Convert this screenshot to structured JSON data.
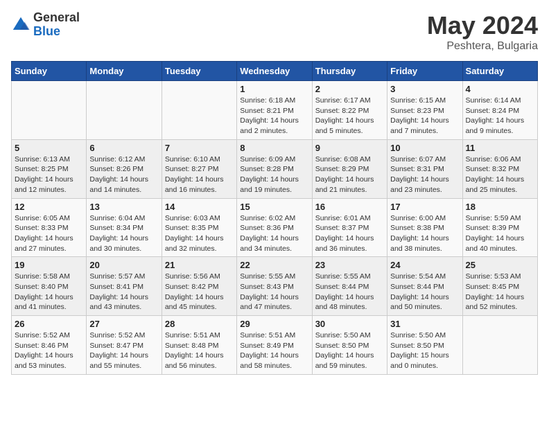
{
  "logo": {
    "general": "General",
    "blue": "Blue"
  },
  "title": {
    "month_year": "May 2024",
    "location": "Peshtera, Bulgaria"
  },
  "days_of_week": [
    "Sunday",
    "Monday",
    "Tuesday",
    "Wednesday",
    "Thursday",
    "Friday",
    "Saturday"
  ],
  "weeks": [
    [
      {
        "day": "",
        "info": ""
      },
      {
        "day": "",
        "info": ""
      },
      {
        "day": "",
        "info": ""
      },
      {
        "day": "1",
        "info": "Sunrise: 6:18 AM\nSunset: 8:21 PM\nDaylight: 14 hours\nand 2 minutes."
      },
      {
        "day": "2",
        "info": "Sunrise: 6:17 AM\nSunset: 8:22 PM\nDaylight: 14 hours\nand 5 minutes."
      },
      {
        "day": "3",
        "info": "Sunrise: 6:15 AM\nSunset: 8:23 PM\nDaylight: 14 hours\nand 7 minutes."
      },
      {
        "day": "4",
        "info": "Sunrise: 6:14 AM\nSunset: 8:24 PM\nDaylight: 14 hours\nand 9 minutes."
      }
    ],
    [
      {
        "day": "5",
        "info": "Sunrise: 6:13 AM\nSunset: 8:25 PM\nDaylight: 14 hours\nand 12 minutes."
      },
      {
        "day": "6",
        "info": "Sunrise: 6:12 AM\nSunset: 8:26 PM\nDaylight: 14 hours\nand 14 minutes."
      },
      {
        "day": "7",
        "info": "Sunrise: 6:10 AM\nSunset: 8:27 PM\nDaylight: 14 hours\nand 16 minutes."
      },
      {
        "day": "8",
        "info": "Sunrise: 6:09 AM\nSunset: 8:28 PM\nDaylight: 14 hours\nand 19 minutes."
      },
      {
        "day": "9",
        "info": "Sunrise: 6:08 AM\nSunset: 8:29 PM\nDaylight: 14 hours\nand 21 minutes."
      },
      {
        "day": "10",
        "info": "Sunrise: 6:07 AM\nSunset: 8:31 PM\nDaylight: 14 hours\nand 23 minutes."
      },
      {
        "day": "11",
        "info": "Sunrise: 6:06 AM\nSunset: 8:32 PM\nDaylight: 14 hours\nand 25 minutes."
      }
    ],
    [
      {
        "day": "12",
        "info": "Sunrise: 6:05 AM\nSunset: 8:33 PM\nDaylight: 14 hours\nand 27 minutes."
      },
      {
        "day": "13",
        "info": "Sunrise: 6:04 AM\nSunset: 8:34 PM\nDaylight: 14 hours\nand 30 minutes."
      },
      {
        "day": "14",
        "info": "Sunrise: 6:03 AM\nSunset: 8:35 PM\nDaylight: 14 hours\nand 32 minutes."
      },
      {
        "day": "15",
        "info": "Sunrise: 6:02 AM\nSunset: 8:36 PM\nDaylight: 14 hours\nand 34 minutes."
      },
      {
        "day": "16",
        "info": "Sunrise: 6:01 AM\nSunset: 8:37 PM\nDaylight: 14 hours\nand 36 minutes."
      },
      {
        "day": "17",
        "info": "Sunrise: 6:00 AM\nSunset: 8:38 PM\nDaylight: 14 hours\nand 38 minutes."
      },
      {
        "day": "18",
        "info": "Sunrise: 5:59 AM\nSunset: 8:39 PM\nDaylight: 14 hours\nand 40 minutes."
      }
    ],
    [
      {
        "day": "19",
        "info": "Sunrise: 5:58 AM\nSunset: 8:40 PM\nDaylight: 14 hours\nand 41 minutes."
      },
      {
        "day": "20",
        "info": "Sunrise: 5:57 AM\nSunset: 8:41 PM\nDaylight: 14 hours\nand 43 minutes."
      },
      {
        "day": "21",
        "info": "Sunrise: 5:56 AM\nSunset: 8:42 PM\nDaylight: 14 hours\nand 45 minutes."
      },
      {
        "day": "22",
        "info": "Sunrise: 5:55 AM\nSunset: 8:43 PM\nDaylight: 14 hours\nand 47 minutes."
      },
      {
        "day": "23",
        "info": "Sunrise: 5:55 AM\nSunset: 8:44 PM\nDaylight: 14 hours\nand 48 minutes."
      },
      {
        "day": "24",
        "info": "Sunrise: 5:54 AM\nSunset: 8:44 PM\nDaylight: 14 hours\nand 50 minutes."
      },
      {
        "day": "25",
        "info": "Sunrise: 5:53 AM\nSunset: 8:45 PM\nDaylight: 14 hours\nand 52 minutes."
      }
    ],
    [
      {
        "day": "26",
        "info": "Sunrise: 5:52 AM\nSunset: 8:46 PM\nDaylight: 14 hours\nand 53 minutes."
      },
      {
        "day": "27",
        "info": "Sunrise: 5:52 AM\nSunset: 8:47 PM\nDaylight: 14 hours\nand 55 minutes."
      },
      {
        "day": "28",
        "info": "Sunrise: 5:51 AM\nSunset: 8:48 PM\nDaylight: 14 hours\nand 56 minutes."
      },
      {
        "day": "29",
        "info": "Sunrise: 5:51 AM\nSunset: 8:49 PM\nDaylight: 14 hours\nand 58 minutes."
      },
      {
        "day": "30",
        "info": "Sunrise: 5:50 AM\nSunset: 8:50 PM\nDaylight: 14 hours\nand 59 minutes."
      },
      {
        "day": "31",
        "info": "Sunrise: 5:50 AM\nSunset: 8:50 PM\nDaylight: 15 hours\nand 0 minutes."
      },
      {
        "day": "",
        "info": ""
      }
    ]
  ]
}
